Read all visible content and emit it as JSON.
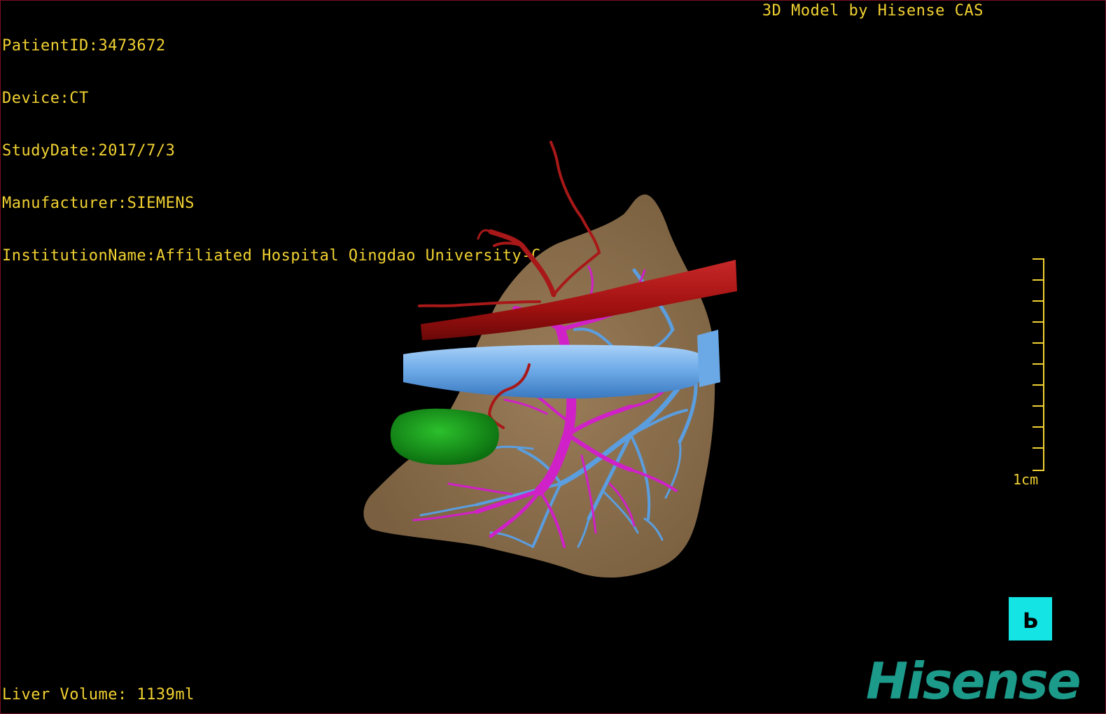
{
  "patient_info": {
    "patient_id": "PatientID:3473672",
    "device": "Device:CT",
    "study_date": "StudyDate:2017/7/3",
    "manufacturer": "Manufacturer:SIEMENS",
    "institution": "InstitutionName:Affiliated Hospital Qingdao University-C"
  },
  "credit": "3D Model by Hisense CAS",
  "liver_volume": "Liver Volume: 1139ml",
  "scale": {
    "label": "1cm"
  },
  "orientation": {
    "letter": "P"
  },
  "logo": {
    "text": "Hisense"
  },
  "colors": {
    "overlay_text": "#f2d232",
    "liver": "#8c7050",
    "artery": "#a81818",
    "vena_cava": "#6aa8e6",
    "hepatic_veins": "#5a9ee0",
    "portal_vein": "#d020c8",
    "lesion": "#1a9a1a",
    "orientation_cube": "#14e4e4",
    "logo": "#1c9a8a"
  }
}
